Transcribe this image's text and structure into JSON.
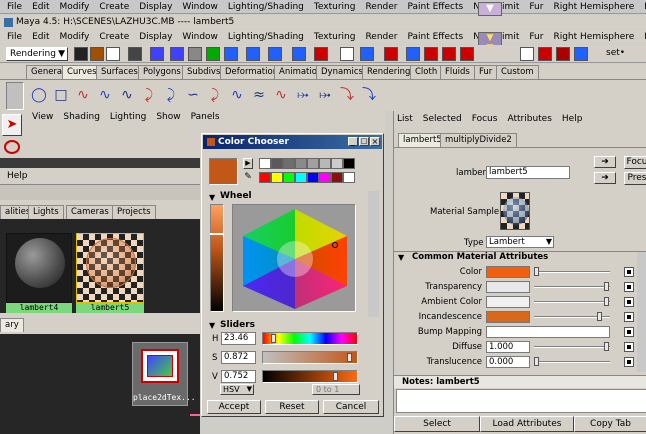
{
  "app": {
    "top_menu": [
      "File",
      "Edit",
      "Modify",
      "Create",
      "Display",
      "Window",
      "Lighting/Shading",
      "Texturing",
      "Render",
      "Paint Effects",
      "Next Limit",
      "Fur",
      "Right Hemisphere",
      "Help"
    ],
    "title": "Maya 4.5: H:\\SCENES\\LAZHU3C.MB   ----   lambert5",
    "main_menu": [
      "File",
      "Edit",
      "Modify",
      "Create",
      "Display",
      "Window",
      "Lighting/Shading",
      "Texturing",
      "Render",
      "Paint Effects",
      "Next Limit",
      "Fur",
      "Right Hemisphere",
      "Help"
    ],
    "menu_set": "Rendering",
    "shelf_tabs": [
      "General",
      "Curves",
      "Surfaces",
      "Polygons",
      "Subdivs",
      "Deformation",
      "Animation",
      "Dynamics",
      "Rendering",
      "Cloth",
      "Fluids",
      "Fur",
      "Custom"
    ],
    "shelf_tab_selected": "Curves",
    "set_label": "set•"
  },
  "viewport": {
    "menu": [
      "View",
      "Shading",
      "Lighting",
      "Show",
      "Panels"
    ]
  },
  "hypershade": {
    "menu": [
      "Help"
    ],
    "tabs": [
      "alities",
      "Lights",
      "Cameras",
      "Projects"
    ],
    "swatches": [
      "lambert4",
      "lambert5"
    ],
    "work_tab": "ary",
    "node_label": "place2dTex..."
  },
  "color_chooser": {
    "title": "Color Chooser",
    "palette_colors": [
      "#ffffff",
      "#5a5a5a",
      "#6e6e6e",
      "#8a8a8a",
      "#a0a0a0",
      "#b8b8b8",
      "#cccccc",
      "#000000",
      "#ff0000",
      "#ffff00",
      "#00ff00",
      "#00ffff",
      "#0000ff",
      "#ff00ff",
      "#8a1010",
      "#ffffff"
    ],
    "current_color": "#c2571a",
    "wheel_label": "Wheel",
    "sliders_label": "Sliders",
    "h_label": "H",
    "s_label": "S",
    "v_label": "V",
    "h_value": "23.46",
    "s_value": "0.872",
    "v_value": "0.752",
    "mode": "HSV",
    "range": "0 to 1",
    "accept": "Accept",
    "reset": "Reset",
    "cancel": "Cancel"
  },
  "attribute_editor": {
    "menu": [
      "List",
      "Selected",
      "Focus",
      "Attributes",
      "Help"
    ],
    "tabs": [
      "lambert5",
      "multiplyDivide2"
    ],
    "node_type_label": "lambert:",
    "node_name": "lambert5",
    "focus_btn": "Focu",
    "presets_btn": "Pres",
    "material_sample_label": "Material Sample",
    "type_label": "Type",
    "type_value": "Lambert",
    "section_title": "Common Material Attributes",
    "attributes": [
      {
        "label": "Color",
        "color": "#f06010",
        "slider": 0
      },
      {
        "label": "Transparency",
        "color": "#e8e8e8",
        "slider": 1
      },
      {
        "label": "Ambient Color",
        "color": "#f0f0f0",
        "slider": 1
      },
      {
        "label": "Incandescence",
        "color": "#d8681c",
        "slider": 0.9
      },
      {
        "label": "Bump Mapping",
        "color": "",
        "slider": null
      },
      {
        "label": "Diffuse",
        "value": "1.000",
        "slider": 1
      },
      {
        "label": "Translucence",
        "value": "0.000",
        "slider": 0
      }
    ],
    "notes_label": "Notes: lambert5",
    "select": "Select",
    "load_attributes": "Load Attributes",
    "copy_tab": "Copy Tab"
  }
}
